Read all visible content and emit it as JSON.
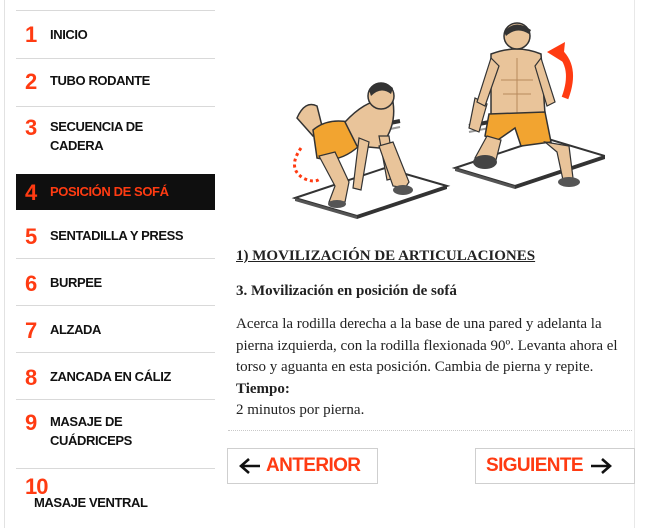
{
  "sidebar": {
    "items": [
      {
        "number": "1",
        "label": "INICIO"
      },
      {
        "number": "2",
        "label": "TUBO RODANTE"
      },
      {
        "number": "3",
        "label": "SECUENCIA DE CADERA"
      },
      {
        "number": "4",
        "label": "POSICIÓN DE SOFÁ",
        "active": true
      },
      {
        "number": "5",
        "label": "SENTADILLA Y PRESS"
      },
      {
        "number": "6",
        "label": "BURPEE"
      },
      {
        "number": "7",
        "label": "ALZADA"
      },
      {
        "number": "8",
        "label": "ZANCADA EN CÁLIZ"
      },
      {
        "number": "9",
        "label": "MASAJE DE CUÁDRICEPS"
      },
      {
        "number": "10",
        "label": "MASAJE VENTRAL"
      }
    ]
  },
  "main": {
    "section_heading": "1) MOVILIZACIÓN DE ARTICULACIONES",
    "exercise_title": "3. Movilización en posición de sofá",
    "description_text": "Acerca la rodilla derecha a la base de una pared y adelanta la pierna izquierda, con la rodilla flexionada 90º. Levanta ahora el torso y aguanta en esta posición. Cambia de pierna y repite.",
    "time_label": "Tiempo:",
    "time_value": "2 minutos por pierna."
  },
  "nav_buttons": {
    "prev_label": "ANTERIOR",
    "next_label": "SIGUIENTE"
  },
  "colors": {
    "accent": "#ff3b12",
    "active_bg": "#0f0f0f",
    "text": "#222222"
  },
  "icons": {
    "prev": "arrow-left-icon",
    "next": "arrow-right-icon"
  }
}
